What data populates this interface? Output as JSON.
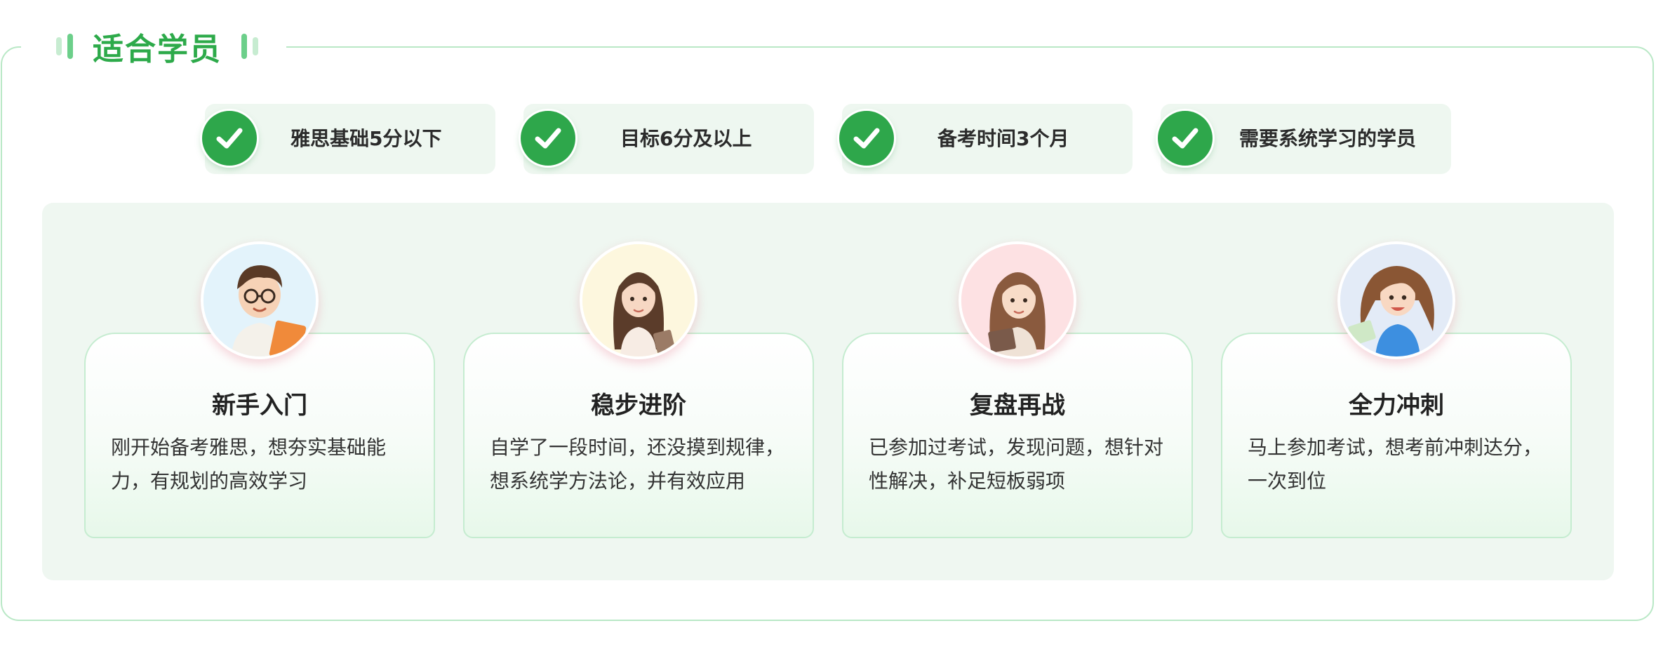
{
  "section": {
    "title": "适合学员"
  },
  "criteria": [
    {
      "label": "雅思基础5分以下",
      "icon": "check-icon"
    },
    {
      "label": "目标6分及以上",
      "icon": "check-icon"
    },
    {
      "label": "备考时间3个月",
      "icon": "check-icon"
    },
    {
      "label": "需要系统学习的学员",
      "icon": "check-icon"
    }
  ],
  "profiles": [
    {
      "title": "新手入门",
      "desc_line1": "刚开始备考雅思，想夯实基础能",
      "desc_line2": "力，有规划的高效学习",
      "avatar": "boy-with-glasses-avatar",
      "avatar_bg": "#e3f3fb"
    },
    {
      "title": "稳步进阶",
      "desc_line1": "自学了一段时间，还没摸到规律，",
      "desc_line2": "想系统学方法论，并有效应用",
      "avatar": "girl-long-hair-avatar",
      "avatar_bg": "#fdf7de"
    },
    {
      "title": "复盘再战",
      "desc_line1": "已参加过考试，发现问题，想针对",
      "desc_line2": "性解决，补足短板弱项",
      "avatar": "girl-with-book-avatar",
      "avatar_bg": "#fde1e3"
    },
    {
      "title": "全力冲刺",
      "desc_line1": "马上参加考试，想考前冲刺达分，",
      "desc_line2": "一次到位",
      "avatar": "girl-running-avatar",
      "avatar_bg": "#e3ebf7"
    }
  ],
  "colors": {
    "accent": "#2daa4a",
    "check": "#2ea74b",
    "frame_border": "#b9e8c6",
    "panel_bg": "#eff7f1"
  }
}
